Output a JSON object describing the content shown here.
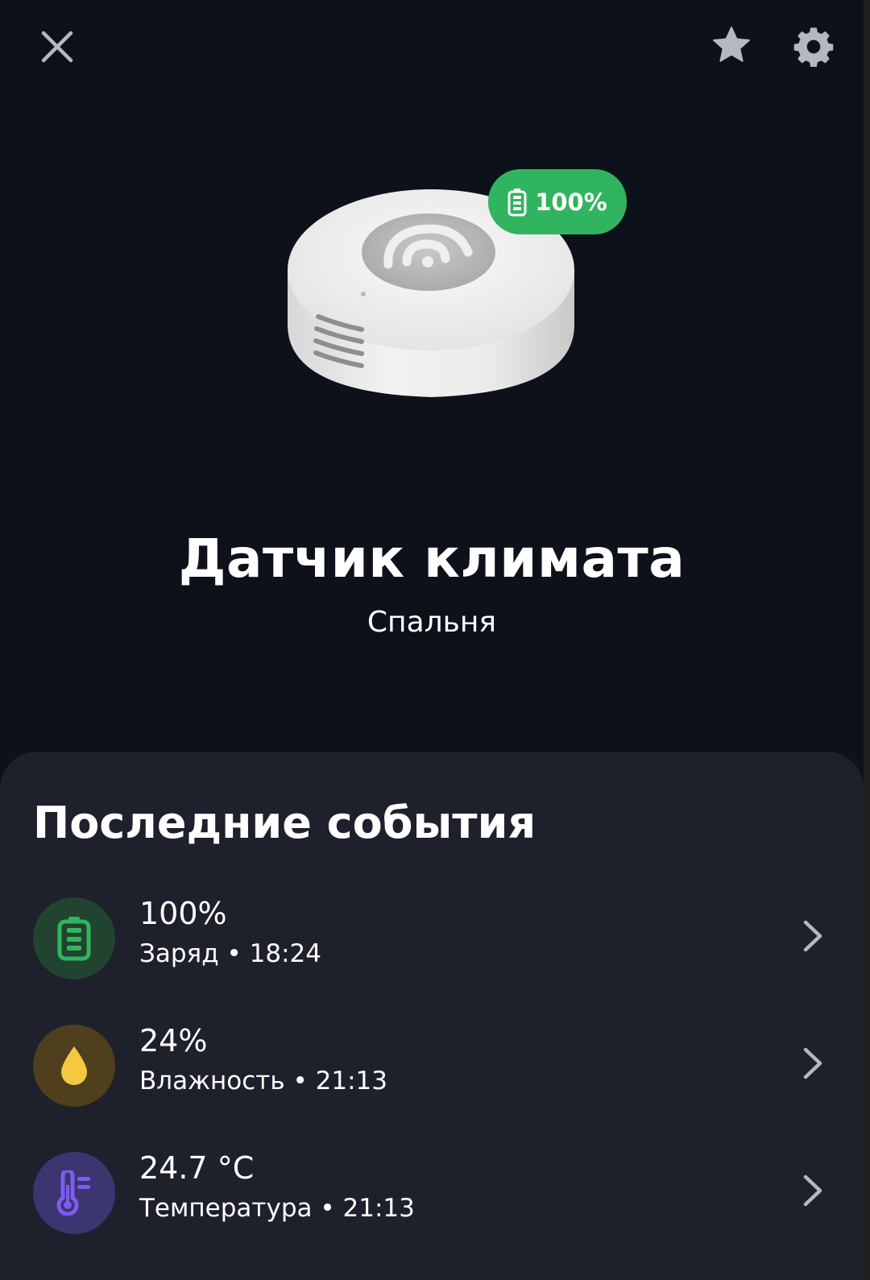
{
  "header": {
    "close_icon": "close-icon",
    "favorite_icon": "star-icon",
    "settings_icon": "gear-icon"
  },
  "device": {
    "battery_badge": "100%",
    "name": "Датчик климата",
    "room": "Спальня"
  },
  "events": {
    "title": "Последние события",
    "items": [
      {
        "value": "100%",
        "label": "Заряд",
        "separator": "•",
        "time": "18:24",
        "icon": "battery-icon",
        "color": "#31b460"
      },
      {
        "value": "24%",
        "label": "Влажность",
        "separator": "•",
        "time": "21:13",
        "icon": "water-drop-icon",
        "color": "#f5c842"
      },
      {
        "value": "24.7 °C",
        "label": "Температура",
        "separator": "•",
        "time": "21:13",
        "icon": "thermometer-icon",
        "color": "#7d5cf0"
      }
    ]
  },
  "colors": {
    "background": "#0d1119",
    "panel": "#1e212c",
    "accent_green": "#31b460"
  }
}
